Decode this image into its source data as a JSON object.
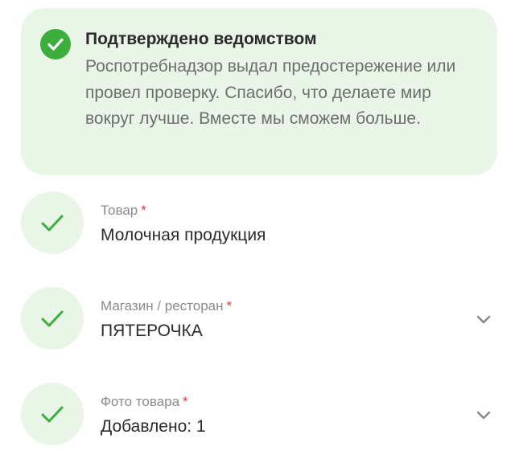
{
  "banner": {
    "icon": "check-circle-icon",
    "title": "Подтверждено ведомством",
    "text": "Роспотребнадзор выдал предостережение или провел проверку. Спасибо, что делаете мир вокруг лучше. Вместе мы сможем больше."
  },
  "fields": [
    {
      "label": "Товар",
      "required": "*",
      "value": "Молочная продукция",
      "icon": "check-icon"
    },
    {
      "label": "Магазин / ресторан",
      "required": "*",
      "value": "ПЯТЕРОЧКА",
      "icon": "check-icon",
      "expand_icon": "chevron-down-icon"
    },
    {
      "label": "Фото товара",
      "required": "*",
      "value": "Добавлено: 1",
      "icon": "check-icon",
      "expand_icon": "chevron-down-icon"
    }
  ],
  "colors": {
    "accent_green": "#3cae3c",
    "light_green_bg": "#e8f5e7",
    "required_red": "#e53935",
    "label_gray": "#8a8a8a",
    "text_dark": "#2b2b2b"
  }
}
